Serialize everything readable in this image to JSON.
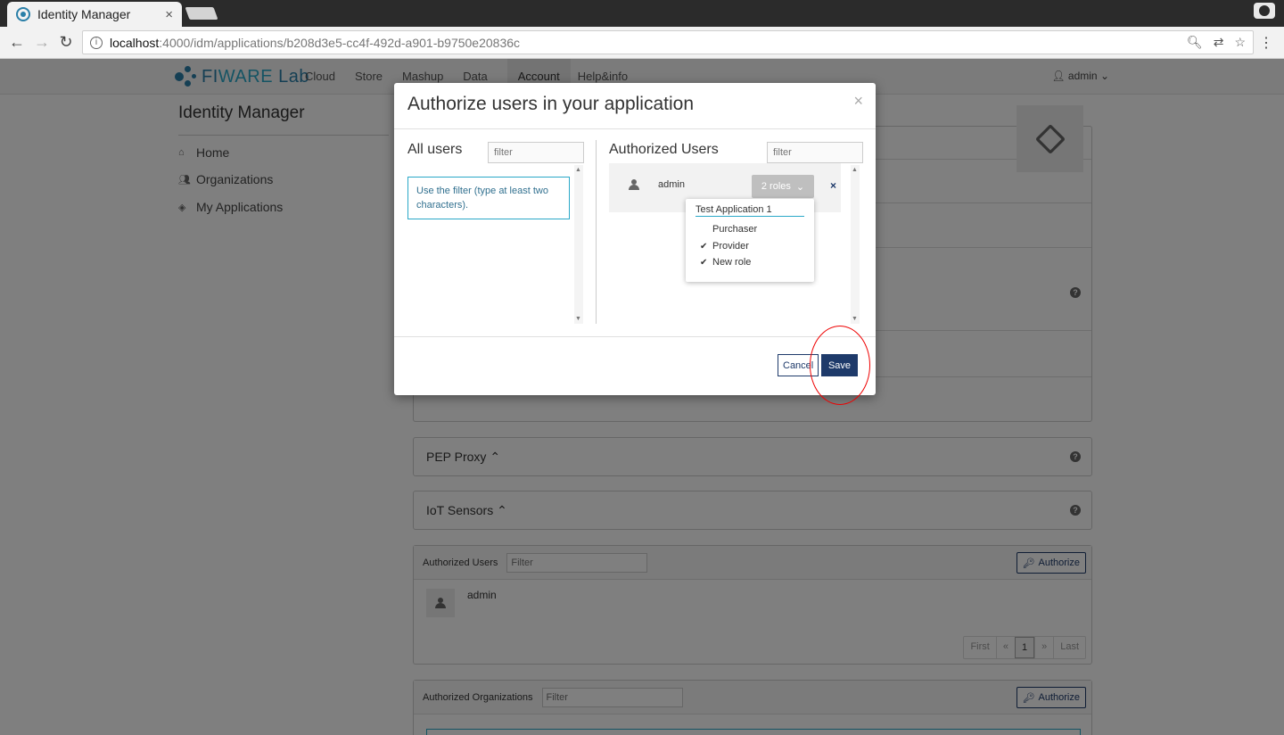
{
  "browser": {
    "tab_title": "Identity Manager",
    "tab_close": "×",
    "url_host": "localhost",
    "url_rest": ":4000/idm/applications/b208d3e5-cc4f-492d-a901-b9750e20836c",
    "icons": [
      "back-icon",
      "forward-icon",
      "reload-icon",
      "info-icon",
      "zoom-icon",
      "translate-icon",
      "bookmark-star-icon",
      "menu-dots-icon",
      "profile-icon"
    ]
  },
  "topnav": {
    "logo_fi": "FI",
    "logo_ware": "WARE",
    "logo_lab": " Lab",
    "links": [
      "Cloud",
      "Store",
      "Mashup",
      "Data",
      "Account",
      "Help&info"
    ],
    "active_link": "Account",
    "user": "admin"
  },
  "sidebar": {
    "title": "Identity Manager",
    "items": [
      {
        "label": "Home",
        "icon": "home-icon"
      },
      {
        "label": "Organizations",
        "icon": "group-icon"
      },
      {
        "label": "My Applications",
        "icon": "cube-icon"
      }
    ]
  },
  "main": {
    "pep_proxy": "PEP Proxy",
    "iot_sensors": "IoT Sensors",
    "authorized_users": {
      "label": "Authorized Users",
      "filter_placeholder": "Filter",
      "authorize_label": "Authorize",
      "users": [
        "admin"
      ],
      "pager": [
        "First",
        "«",
        "1",
        "»",
        "Last"
      ],
      "current_page": "1"
    },
    "authorized_orgs": {
      "label": "Authorized Organizations",
      "filter_placeholder": "Filter",
      "authorize_label": "Authorize"
    }
  },
  "modal": {
    "title": "Authorize users in your application",
    "close": "×",
    "all_users": {
      "title": "All users",
      "filter_placeholder": "filter",
      "hint": "Use the filter (type at least two characters)."
    },
    "authorized_users": {
      "title": "Authorized Users",
      "filter_placeholder": "filter",
      "user": "admin",
      "roles_label": "2 roles",
      "remove": "×",
      "roles_dropdown": {
        "application": "Test Application 1",
        "roles": [
          {
            "name": "Purchaser",
            "checked": false
          },
          {
            "name": "Provider",
            "checked": true
          },
          {
            "name": "New role",
            "checked": true
          }
        ]
      }
    },
    "cancel_label": "Cancel",
    "save_label": "Save"
  },
  "colors": {
    "brand": "#2a7fa8",
    "primary_button": "#1e3a6a",
    "highlight_ring": "#e00000",
    "info_border": "#2aa8c8"
  }
}
